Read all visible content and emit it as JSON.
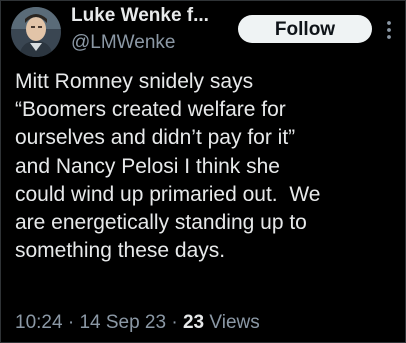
{
  "author": {
    "display_name": "Luke Wenke f...",
    "handle": "@LMWenke",
    "avatar_icon": "user-avatar"
  },
  "follow_button": {
    "label": "Follow"
  },
  "more_menu": {
    "icon": "more-vertical-icon"
  },
  "tweet": {
    "text": "Mitt Romney snidely says\n“Boomers created welfare for\nourselves and didn’t pay for it”\nand Nancy Pelosi I think she\ncould wind up primaried out.  We\nare energetically standing up to\nsomething these days."
  },
  "meta": {
    "time": "10:24",
    "separator": "·",
    "date": "14 Sep 23",
    "views_count": "23",
    "views_label": "Views"
  },
  "colors": {
    "background": "#000000",
    "primary_text": "#e7e9ea",
    "secondary_text": "#8b98a5",
    "button_bg": "#eff3f4",
    "button_text": "#0f1419"
  }
}
